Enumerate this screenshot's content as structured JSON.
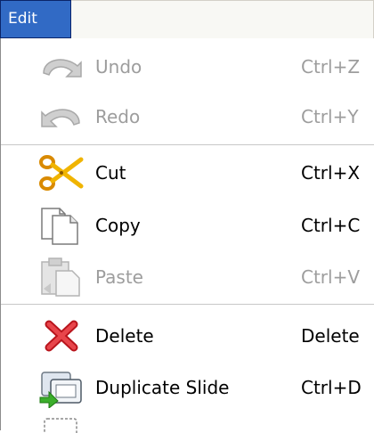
{
  "menubar": {
    "title": "Edit"
  },
  "menu": {
    "items": [
      {
        "label": "Undo",
        "shortcut": "Ctrl+Z",
        "icon": "undo-icon",
        "enabled": false
      },
      {
        "label": "Redo",
        "shortcut": "Ctrl+Y",
        "icon": "redo-icon",
        "enabled": false
      },
      {
        "label": "Cut",
        "shortcut": "Ctrl+X",
        "icon": "cut-icon",
        "enabled": true
      },
      {
        "label": "Copy",
        "shortcut": "Ctrl+C",
        "icon": "copy-icon",
        "enabled": true
      },
      {
        "label": "Paste",
        "shortcut": "Ctrl+V",
        "icon": "paste-icon",
        "enabled": false
      },
      {
        "label": "Delete",
        "shortcut": "Delete",
        "icon": "delete-icon",
        "enabled": true
      },
      {
        "label": "Duplicate Slide",
        "shortcut": "Ctrl+D",
        "icon": "duplicate-slide-icon",
        "enabled": true
      }
    ]
  },
  "colors": {
    "highlight": "#316ac5",
    "disabled_text": "#9d9d9d",
    "separator": "#c8c8c8"
  }
}
